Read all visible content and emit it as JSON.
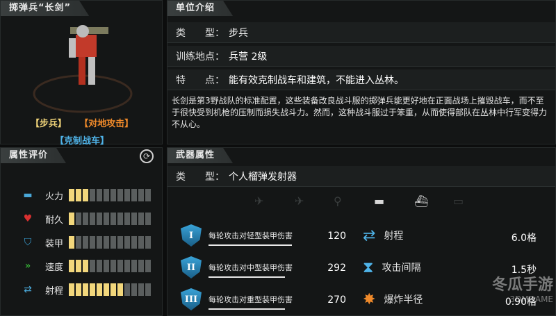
{
  "unit": {
    "name": "掷弹兵“长剑”",
    "tags": [
      "【步兵】",
      "【对地攻击】",
      "【克制战车】"
    ],
    "section_attributes": "属性评价"
  },
  "stats": [
    {
      "label": "火力",
      "icon": "bullets-icon",
      "filled": 3,
      "total": 12,
      "color": "#4aa8d8"
    },
    {
      "label": "耐久",
      "icon": "heart-icon",
      "filled": 1,
      "total": 12,
      "color": "#d93030"
    },
    {
      "label": "装甲",
      "icon": "shield-icon",
      "filled": 1,
      "total": 12,
      "color": "#3aa3d8"
    },
    {
      "label": "速度",
      "icon": "double-chevron-icon",
      "filled": 3,
      "total": 12,
      "color": "#3cc83c"
    },
    {
      "label": "射程",
      "icon": "range-arrows-icon",
      "filled": 8,
      "total": 12,
      "color": "#4aa8d8"
    }
  ],
  "intro": {
    "header": "单位介绍",
    "rows": [
      {
        "key": "类　　型：",
        "value": "步兵"
      },
      {
        "key": "训练地点：",
        "value": "兵营 2级"
      },
      {
        "key": "特　　点：",
        "value": "能有效克制战车和建筑，不能进入丛林。"
      }
    ],
    "description": "长剑是第3野战队的标准配置，这些装备改良战斗服的掷弹兵能更好地在正面战场上摧毁战车，而不至于很快受到机枪的压制而损失战斗力。然而，这种战斗服过于笨重，从而使得部队在丛林中行军变得力不从心。"
  },
  "weapon": {
    "header": "武器属性",
    "type_key": "类　　型：",
    "type_value": "个人榴弹发射器",
    "targets": [
      "jet-icon",
      "plane-icon",
      "helicopter-icon",
      "tank-icon",
      "ship-icon",
      "submarine-icon"
    ],
    "damage": [
      {
        "numeral": "I",
        "label": "每轮攻击对轻型装甲伤害",
        "value": "120"
      },
      {
        "numeral": "II",
        "label": "每轮攻击对中型装甲伤害",
        "value": "292"
      },
      {
        "numeral": "III",
        "label": "每轮攻击对重型装甲伤害",
        "value": "270"
      }
    ],
    "props": [
      {
        "icon": "range-arrows-icon",
        "label": "射程",
        "value": "6.0格"
      },
      {
        "icon": "hourglass-icon",
        "label": "攻击间隔",
        "value": "1.5秒"
      },
      {
        "icon": "explosion-icon",
        "label": "爆炸半径",
        "value": "0.90格"
      }
    ]
  },
  "watermark": {
    "brand": "冬瓜手游",
    "sub": "3DMGAME"
  }
}
